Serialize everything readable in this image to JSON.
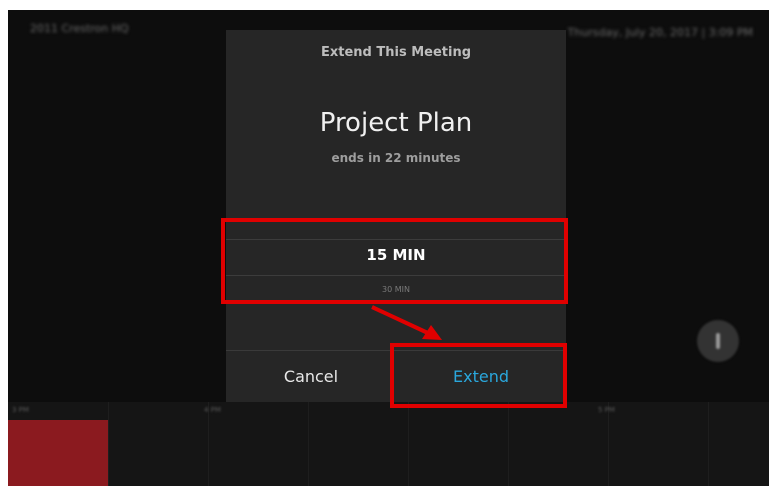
{
  "header": {
    "location": "2011 Crestron HQ",
    "datetime": "Thursday, July 20, 2017 | 3:09 PM"
  },
  "timeline": {
    "labels": [
      "3 PM",
      "4 PM",
      "5 PM"
    ]
  },
  "dialog": {
    "title": "Extend This Meeting",
    "meeting_name": "Project Plan",
    "ends_in": "ends in 22 minutes",
    "picker": {
      "selected": "15 MIN",
      "next": "30 MIN"
    },
    "cancel_label": "Cancel",
    "extend_label": "Extend"
  },
  "colors": {
    "extend_accent": "#2aa7dc",
    "highlight": "#e00000",
    "busy_block": "#8b1a1f"
  },
  "icons": {
    "info": "info-icon",
    "arrow": "arrow-annotation"
  }
}
